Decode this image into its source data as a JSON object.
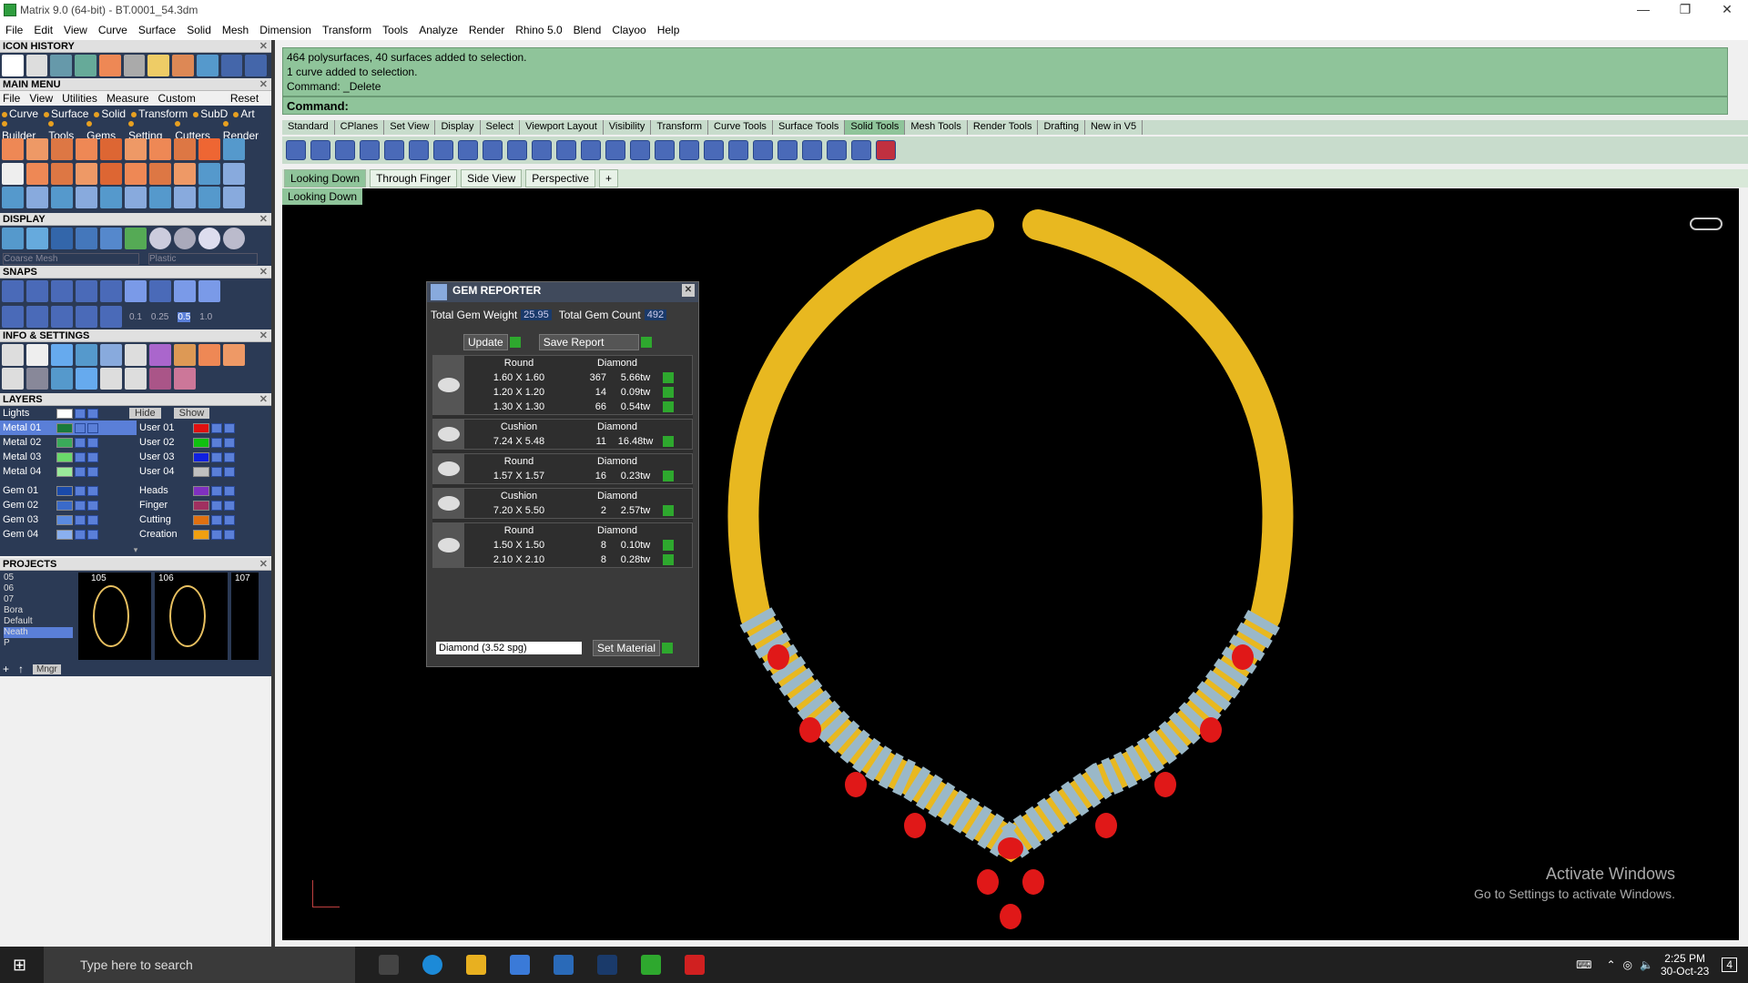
{
  "window": {
    "title": "Matrix 9.0 (64-bit) - BT.0001_54.3dm"
  },
  "menubar": [
    "File",
    "Edit",
    "View",
    "Curve",
    "Surface",
    "Solid",
    "Mesh",
    "Dimension",
    "Transform",
    "Tools",
    "Analyze",
    "Render",
    "Rhino 5.0",
    "Blend",
    "Clayoo",
    "Help"
  ],
  "left": {
    "icon_history": "ICON HISTORY",
    "main_menu": "MAIN MENU",
    "main_menu_row1": [
      "File",
      "View",
      "Utilities",
      "Measure",
      "Custom",
      "Reset"
    ],
    "main_menu_row2": [
      "Curve",
      "Surface",
      "Solid",
      "Transform",
      "SubD",
      "Art"
    ],
    "main_menu_row3": [
      "Builder",
      "Tools",
      "Gems",
      "Setting",
      "Cutters",
      "Render"
    ],
    "display": "DISPLAY",
    "display_mesh": "Coarse Mesh",
    "display_material": "Plastic",
    "snaps": "SNAPS",
    "snap_values": [
      "0.1",
      "0.25",
      "0.5",
      "1.0"
    ],
    "info": "INFO & SETTINGS",
    "layers": "LAYERS",
    "lights": "Lights",
    "hide": "Hide",
    "show": "Show",
    "layer_left": [
      "Metal 01",
      "Metal 02",
      "Metal 03",
      "Metal 04",
      "Gem 01",
      "Gem 02",
      "Gem 03",
      "Gem 04"
    ],
    "layer_right": [
      "User 01",
      "User 02",
      "User 03",
      "User 04",
      "Heads",
      "Finger",
      "Cutting",
      "Creation"
    ],
    "projects": "PROJECTS",
    "project_list": [
      "05",
      "06",
      "07",
      "Bora",
      "Default",
      "Neath",
      "P"
    ],
    "project_nums": [
      "105",
      "106",
      "107"
    ],
    "mngr": "Mngr"
  },
  "command": {
    "lines": [
      "464 polysurfaces, 40 surfaces added to selection.",
      "1 curve added to selection.",
      "Command: _Delete"
    ],
    "prompt": "Command:"
  },
  "toolbar_tabs": [
    "Standard",
    "CPlanes",
    "Set View",
    "Display",
    "Select",
    "Viewport Layout",
    "Visibility",
    "Transform",
    "Curve Tools",
    "Surface Tools",
    "Solid Tools",
    "Mesh Tools",
    "Render Tools",
    "Drafting",
    "New in V5"
  ],
  "viewport_tabs": [
    "Looking Down",
    "Through Finger",
    "Side View",
    "Perspective",
    "+"
  ],
  "viewport_label": "Looking Down",
  "gem_reporter": {
    "title": "GEM REPORTER",
    "total_weight_label": "Total Gem Weight",
    "total_weight": "25.95",
    "total_count_label": "Total Gem Count",
    "total_count": "492",
    "update": "Update",
    "save_report": "Save Report",
    "groups": [
      {
        "shape": "Round",
        "material": "Diamond",
        "rows": [
          [
            "1.60 X 1.60",
            "367",
            "5.66tw"
          ],
          [
            "1.20 X 1.20",
            "14",
            "0.09tw"
          ],
          [
            "1.30 X 1.30",
            "66",
            "0.54tw"
          ]
        ]
      },
      {
        "shape": "Cushion",
        "material": "Diamond",
        "rows": [
          [
            "7.24 X 5.48",
            "11",
            "16.48tw"
          ]
        ]
      },
      {
        "shape": "Round",
        "material": "Diamond",
        "rows": [
          [
            "1.57 X 1.57",
            "16",
            "0.23tw"
          ]
        ]
      },
      {
        "shape": "Cushion",
        "material": "Diamond",
        "rows": [
          [
            "7.20 X 5.50",
            "2",
            "2.57tw"
          ]
        ]
      },
      {
        "shape": "Round",
        "material": "Diamond",
        "rows": [
          [
            "1.50 X 1.50",
            "8",
            "0.10tw"
          ],
          [
            "2.10 X 2.10",
            "8",
            "0.28tw"
          ]
        ]
      }
    ],
    "material_select": "Diamond    (3.52 spg)",
    "set_material": "Set Material"
  },
  "watermark": {
    "line1": "Activate Windows",
    "line2": "Go to Settings to activate Windows."
  },
  "taskbar": {
    "search_placeholder": "Type here to search",
    "time": "2:25 PM",
    "date": "30-Oct-23",
    "notif": "4"
  }
}
